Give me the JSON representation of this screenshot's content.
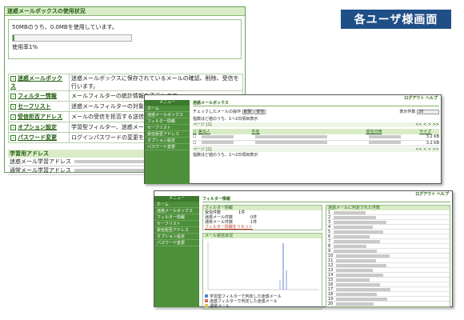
{
  "badge": "各ユーザ様画面",
  "w1": {
    "title": "迷惑メールボックスの使用状況",
    "usage_text": "50MBのうち、0.0MBを使用しています。",
    "usage_rate": "使用率1%",
    "usage_fraction": 0.01,
    "menu": [
      {
        "label": "迷惑メールボックス",
        "desc": "迷惑メールボックスに保存されているメールの確認、削除、受信を行います。"
      },
      {
        "label": "フィルター情報",
        "desc": "メールフィルターの統計情報を表示します。"
      },
      {
        "label": "セーフリスト",
        "desc": "迷惑メールフィルターの対象とし"
      },
      {
        "label": "受信拒否アドレス",
        "desc": "メールの受信を拒否する送信"
      },
      {
        "label": "オプション設定",
        "desc": "学習型フィルター、迷惑メール"
      },
      {
        "label": "パスワード変更",
        "desc": "ログインパスワードの変更をし"
      }
    ],
    "learn_title": "学習用アドレス",
    "learn_rows": [
      "迷惑メール学習アドレス",
      "通常メール学習アドレス"
    ]
  },
  "w2": {
    "top_links": [
      "ログアウト",
      "ヘルプ"
    ],
    "menu_title": "メニュー",
    "menu": [
      "ホーム",
      "迷惑メールボックス",
      "フィルター情報",
      "セーフリスト",
      "受信拒否アドレス",
      "オプション設定",
      "パスワード変更"
    ],
    "title": "迷惑メールボックス",
    "ops_label": "チェックしたメールの操作",
    "btn_delete": "削除",
    "btn_receive": "受信",
    "per_page_label": "表示件数",
    "per_page_value": "20",
    "summary": "指数ほど値のうち、1〜2日項目表示",
    "page": "ページ [1]",
    "nav": "<< < > >>",
    "headers": [
      "差出人",
      "件名",
      "受信日時",
      "サイズ"
    ],
    "rows": [
      [
        "",
        "",
        "",
        "3.2 KB"
      ],
      [
        "",
        "",
        "",
        "3.2 KB"
      ]
    ]
  },
  "w3": {
    "top_links": [
      "ログアウト",
      "ヘルプ"
    ],
    "menu_title": "メニュー",
    "menu": [
      "ホーム",
      "迷惑メールボックス",
      "フィルター情報",
      "セーフリスト",
      "受信拒否アドレス",
      "オプション設定",
      "パスワード変更"
    ],
    "title": "フィルター情報",
    "stats_title": "フィルター情報",
    "stats": [
      [
        "受信件数",
        "1件"
      ],
      [
        "迷惑メール件数",
        "0件"
      ],
      [
        "通常メール件数",
        "1件"
      ]
    ],
    "stats_link": "フィルター情報をリセット",
    "chart_title": "メール受信状況",
    "legend": [
      "学習型フィルターで判定した迷惑メール",
      "迷惑フィルターで判定した迷惑メール",
      "通常メール"
    ],
    "right_title": "迷惑メールに判定された件数",
    "right_rows": [
      "1",
      "2",
      "3",
      "4",
      "5",
      "6",
      "7",
      "8",
      "9",
      "10",
      "11",
      "12",
      "13",
      "14",
      "15",
      "16",
      "17",
      "18",
      "19",
      "20"
    ]
  },
  "colors": {
    "accent": "#1f4f86",
    "green": "#4e8f3c",
    "header_bg": "#d9ecc7"
  }
}
